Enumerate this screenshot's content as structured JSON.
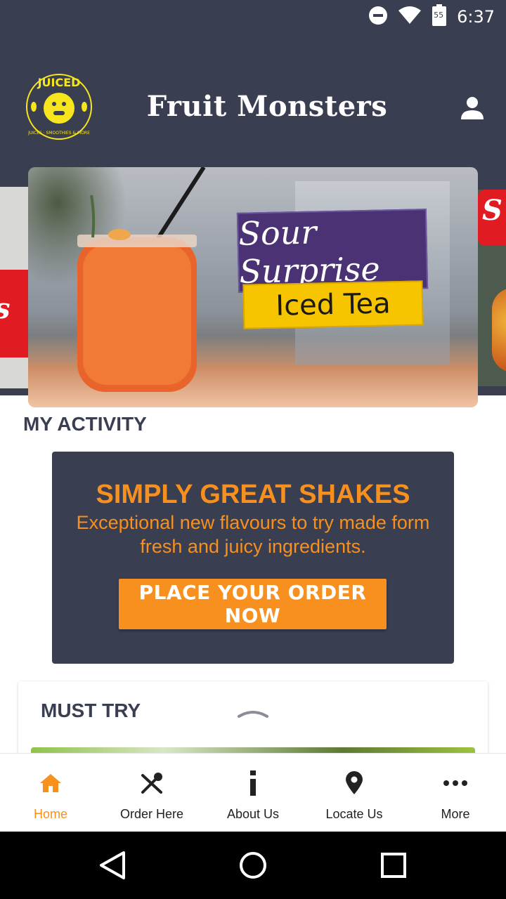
{
  "status_bar": {
    "time": "6:37",
    "battery_level": "55"
  },
  "header": {
    "logo_text": "JUICED",
    "logo_tagline": "JUICES · SMOOTHIES & MORE",
    "title": "Fruit Monsters"
  },
  "carousel": {
    "left_slide_text": "s",
    "right_slide_text": "S",
    "main_slide": {
      "sign_line1": "Sour Surprise",
      "sign_line2": "Iced Tea"
    }
  },
  "activity": {
    "section_title": "MY ACTIVITY",
    "promo": {
      "title": "SIMPLY GREAT SHAKES",
      "subtitle": "Exceptional new flavours to try made form fresh and juicy ingredients.",
      "button_label": "PLACE YOUR ORDER NOW"
    }
  },
  "must_try": {
    "title": "MUST TRY"
  },
  "bottom_nav": {
    "items": [
      {
        "label": "Home",
        "icon": "home-icon"
      },
      {
        "label": "Order Here",
        "icon": "utensils-icon"
      },
      {
        "label": "About Us",
        "icon": "info-icon"
      },
      {
        "label": "Locate Us",
        "icon": "location-pin-icon"
      },
      {
        "label": "More",
        "icon": "more-dots-icon"
      }
    ]
  },
  "colors": {
    "primary_dark": "#3a3e51",
    "accent_orange": "#f7901e",
    "white": "#ffffff"
  }
}
